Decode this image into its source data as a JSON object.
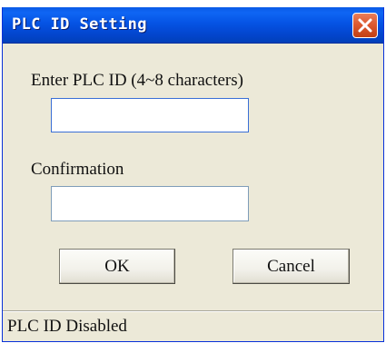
{
  "window": {
    "title": "PLC ID Setting",
    "close_icon": "close-icon"
  },
  "form": {
    "plc_id_label": "Enter PLC ID (4~8 characters)",
    "plc_id_value": "",
    "confirmation_label": "Confirmation",
    "confirmation_value": ""
  },
  "buttons": {
    "ok_label": "OK",
    "cancel_label": "Cancel"
  },
  "status": {
    "text": "PLC ID Disabled"
  },
  "colors": {
    "titlebar": "#0553e4",
    "close_button": "#dd5a30",
    "dialog_background": "#ece9d8",
    "input_border_focused": "#3a6fd6"
  }
}
